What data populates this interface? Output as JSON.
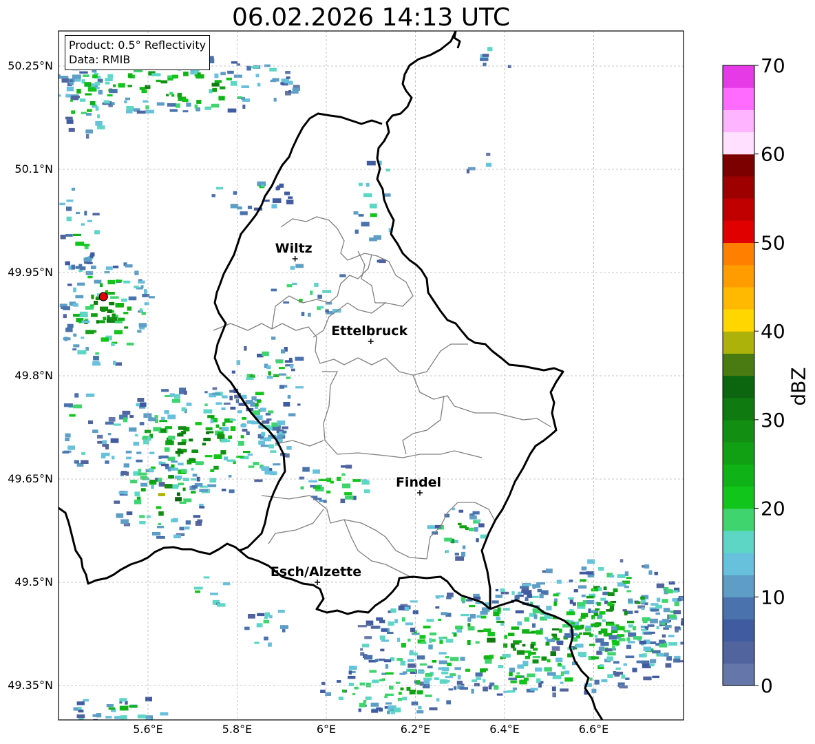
{
  "title": "06.02.2026 14:13 UTC",
  "info": {
    "product": "Product: 0.5° Reflectivity",
    "source": "Data: RMIB"
  },
  "axes": {
    "lon_ticks": [
      "5.6°E",
      "5.8°E",
      "6°E",
      "6.2°E",
      "6.4°E",
      "6.6°E"
    ],
    "lat_ticks": [
      "50.25°N",
      "50.1°N",
      "49.95°N",
      "49.8°N",
      "49.65°N",
      "49.5°N",
      "49.35°N"
    ]
  },
  "cities": [
    {
      "name": "Wiltz",
      "lon": 5.93,
      "lat": 49.97
    },
    {
      "name": "Ettelbruck",
      "lon": 6.1,
      "lat": 49.85
    },
    {
      "name": "Findel",
      "lon": 6.21,
      "lat": 49.63
    },
    {
      "name": "Esch/Alzette",
      "lon": 5.98,
      "lat": 49.5
    }
  ],
  "radar_site": {
    "lon": 5.5,
    "lat": 49.915
  },
  "colorbar": {
    "unit": "dBZ",
    "tick_labels": [
      "0",
      "10",
      "20",
      "30",
      "40",
      "50",
      "60",
      "70"
    ],
    "colors": [
      "#6577a8",
      "#51649e",
      "#405ba0",
      "#4a72ad",
      "#5d9dc6",
      "#67c1dc",
      "#5ed6c6",
      "#3fd46e",
      "#12c51a",
      "#10b317",
      "#119f13",
      "#128e12",
      "#0f7a0f",
      "#0c6610",
      "#4a7a12",
      "#adb20a",
      "#ffd600",
      "#ffb900",
      "#ff9c00",
      "#ff7f00",
      "#e00000",
      "#c00000",
      "#9e0000",
      "#7b0000",
      "#ffe1ff",
      "#ffb4ff",
      "#ff6aff",
      "#e53ae6"
    ]
  },
  "colors": {
    "border": "#000000",
    "cantons": "#7f7f7f",
    "grid": "#b0b0b0",
    "radar_dot": "#e00000"
  }
}
